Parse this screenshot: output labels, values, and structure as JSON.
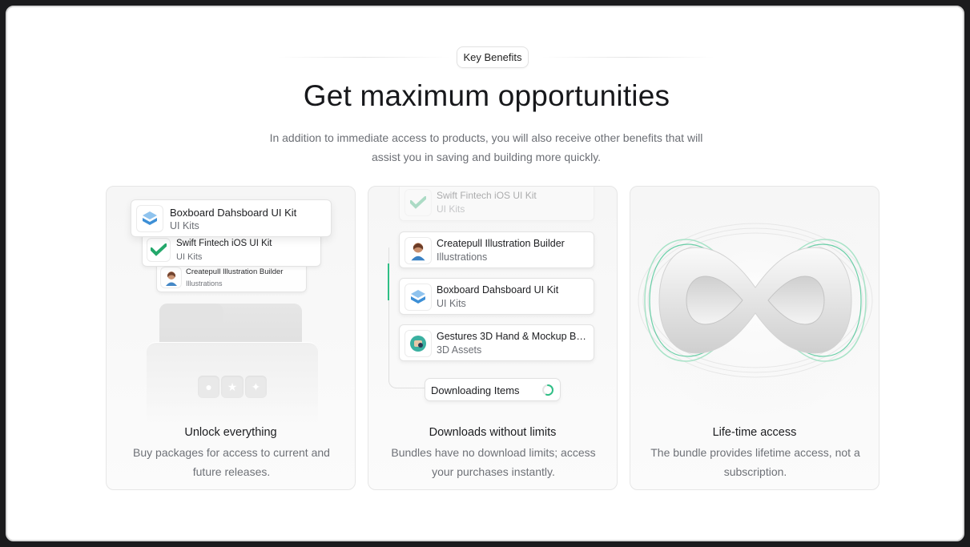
{
  "header": {
    "badge": "Key Benefits",
    "title": "Get maximum opportunities",
    "subtitle": "In addition to immediate access to products, you will also receive other benefits that will assist you in saving and building more quickly."
  },
  "cards": [
    {
      "title": "Unlock everything",
      "description": "Buy packages for access to current and future releases.",
      "items": [
        {
          "name": "Boxboard Dahsboard UI Kit",
          "category": "UI Kits"
        },
        {
          "name": "Swift Fintech iOS UI Kit",
          "category": "UI Kits"
        },
        {
          "name": "Createpull Illustration Builder",
          "category": "Illustrations"
        }
      ]
    },
    {
      "title": "Downloads without limits",
      "description": "Bundles have no download limits; access your purchases instantly.",
      "items": [
        {
          "name": "Swift Fintech iOS UI Kit",
          "category": "UI Kits"
        },
        {
          "name": "Createpull Illustration Builder",
          "category": "Illustrations"
        },
        {
          "name": "Boxboard Dahsboard UI Kit",
          "category": "UI Kits"
        },
        {
          "name": "Gestures 3D Hand & Mockup Bu…",
          "category": "3D Assets"
        }
      ],
      "download_label": "Downloading Items"
    },
    {
      "title": "Life-time access",
      "description": "The bundle provides lifetime access, not a subscription."
    }
  ],
  "colors": {
    "accent_green": "#2fbf86",
    "boxboard_blue": "#3d8fd6",
    "swift_green": "#23a86b"
  },
  "icons": [
    "boxboard-logo-icon",
    "swift-logo-icon",
    "avatar-illustration-icon",
    "gestures-3d-icon",
    "folder-icon",
    "infinity-icon",
    "spinner-icon",
    "star-icon"
  ]
}
